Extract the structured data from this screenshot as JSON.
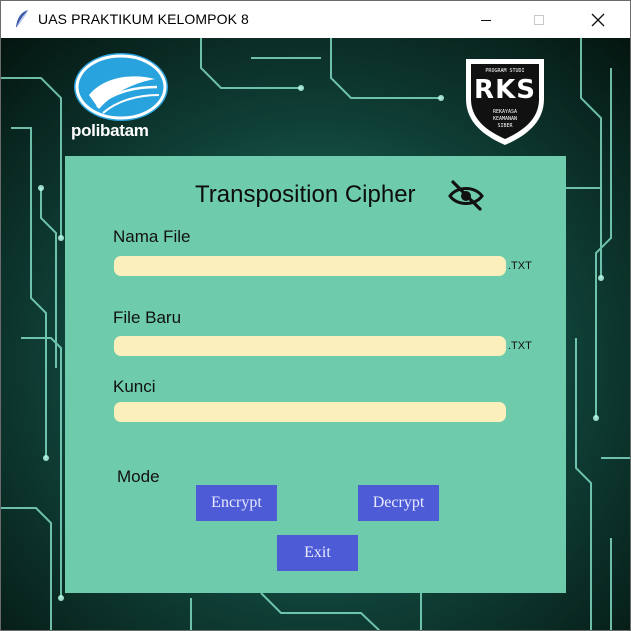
{
  "window": {
    "title": "UAS PRAKTIKUM KELOMPOK 8",
    "controls": {
      "minimize": "minimize-icon",
      "maximize": "maximize-icon",
      "close": "close-icon"
    }
  },
  "logos": {
    "left": {
      "text": "polibatam"
    },
    "right": {
      "top_text": "PROGRAM STUDI",
      "main_text": "RKS",
      "sub_lines": [
        "REKAYASA",
        "KEAMANAN",
        "SIBER"
      ]
    }
  },
  "form": {
    "heading": "Transposition Cipher",
    "icon": "eye-slash-icon",
    "file_name": {
      "label": "Nama File",
      "value": "",
      "ext": ".TXT"
    },
    "new_file": {
      "label": "File Baru",
      "value": "",
      "ext": ".TXT"
    },
    "key": {
      "label": "Kunci",
      "value": ""
    },
    "mode": {
      "label": "Mode"
    },
    "buttons": {
      "encrypt": "Encrypt",
      "decrypt": "Decrypt",
      "exit": "Exit"
    }
  },
  "colors": {
    "panel": "#6ecbac",
    "field": "#fbf0bc",
    "button": "#4e5bd6",
    "background": "#061a17",
    "circuit": "#7fe0c8"
  }
}
